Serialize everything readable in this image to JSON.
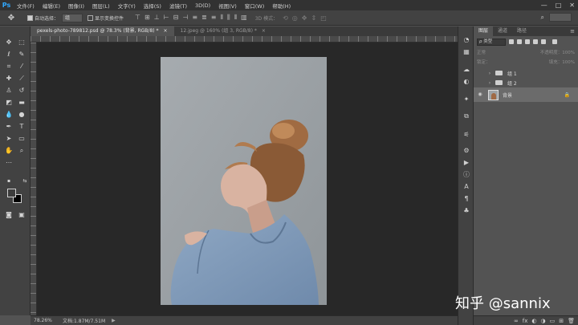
{
  "app": {
    "logo": "Ps"
  },
  "menu": [
    "文件(F)",
    "编辑(E)",
    "图像(I)",
    "图层(L)",
    "文字(Y)",
    "选择(S)",
    "滤镜(T)",
    "3D(D)",
    "视图(V)",
    "窗口(W)",
    "帮助(H)"
  ],
  "window_controls": {
    "minimize": "—",
    "restore": "□",
    "close": "✕"
  },
  "options": {
    "move_icon": "✥",
    "auto_select_label": "自动选择：",
    "auto_select_value": "组",
    "show_transform_label": "显示变换控件",
    "mode3d_label": "3D 模式："
  },
  "tabs": [
    {
      "label": "pexels-photo-789812.psd @ 78.3% (背景, RGB/8) *",
      "close": "×",
      "active": true
    },
    {
      "label": "12.jpeg @ 160% (组 3, RGB/8) *",
      "close": "×",
      "active": false
    }
  ],
  "status": {
    "zoom": "78.26%",
    "doc": "文档:1.87M/7.51M",
    "arrow": "▶"
  },
  "panel": {
    "tabs": [
      "图层",
      "通道",
      "路径"
    ],
    "menu_icon": "≡",
    "filter_label": "ρ 类型",
    "mode_label": "正常",
    "opacity_label": "不透明度：100%",
    "lock_label": "锁定：",
    "fill_label": "填充：100%",
    "layers": [
      {
        "name": "组 1",
        "type": "group"
      },
      {
        "name": "组 2",
        "type": "group"
      },
      {
        "name": "背景",
        "type": "image",
        "selected": true
      }
    ],
    "lock_icon": "🔒",
    "eye_icon": "◉",
    "group_arrow": "›",
    "bottom_icons": [
      "∞",
      "fx",
      "◐",
      "◑",
      "▭",
      "⊞",
      "🗑"
    ]
  },
  "watermark": "知乎 @sannix",
  "colors": {
    "foreground": "#3c3c3c",
    "background": "#000000",
    "accent": "#31a8ff"
  }
}
